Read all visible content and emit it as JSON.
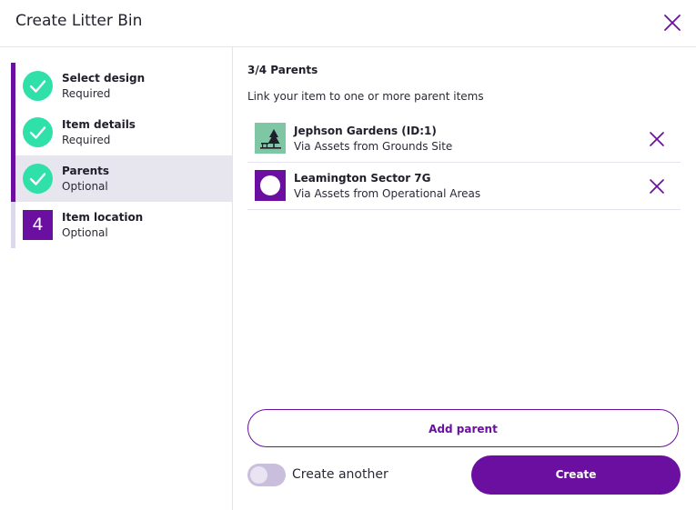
{
  "dialog": {
    "title": "Create Litter Bin"
  },
  "colors": {
    "accent": "#6a0fa0",
    "success": "#2fe0a8",
    "active_step_bg": "#e7e5ee"
  },
  "steps": [
    {
      "label": "Select design",
      "sub": "Required",
      "status": "complete",
      "icon": "check-icon"
    },
    {
      "label": "Item details",
      "sub": "Required",
      "status": "complete",
      "icon": "check-icon"
    },
    {
      "label": "Parents",
      "sub": "Optional",
      "status": "complete-active",
      "icon": "check-icon"
    },
    {
      "label": "Item location",
      "sub": "Optional",
      "status": "pending",
      "number": "4"
    }
  ],
  "main": {
    "section_title": "3/4 Parents",
    "description": "Link your item to one or more parent items",
    "parents": [
      {
        "name": "Jephson Gardens (ID:1)",
        "via": "Via Assets from Grounds Site",
        "icon": "park-tree-icon",
        "thumb_color": "#7fc7a4"
      },
      {
        "name": "Leamington Sector 7G",
        "via": "Via Assets from Operational Areas",
        "icon": "circle-area-icon",
        "thumb_color": "#6a0fa0"
      }
    ],
    "add_parent_label": "Add parent",
    "create_another_label": "Create another",
    "create_another_enabled": false,
    "create_label": "Create"
  }
}
